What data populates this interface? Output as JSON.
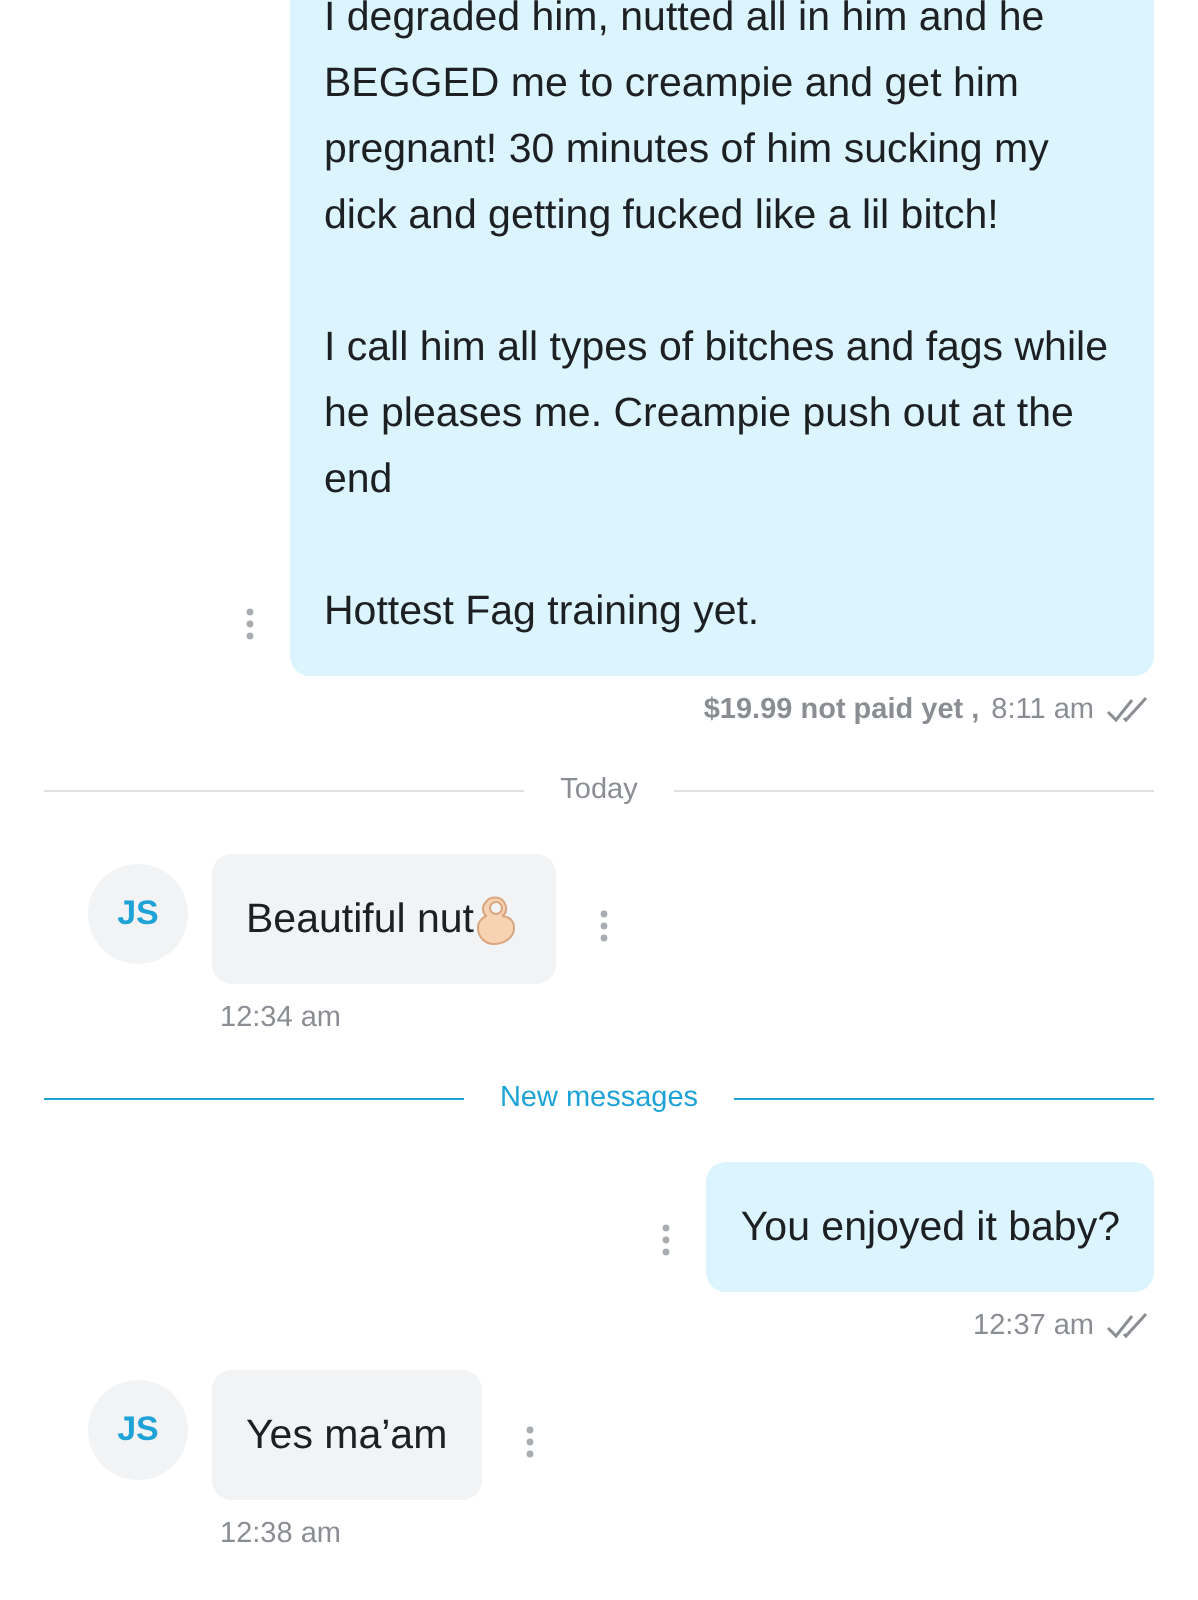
{
  "messages": [
    {
      "kind": "sent",
      "paragraphs": [
        "I degraded him, nutted all in him and he BEGGED me to creampie and get him pregnant! 30 minutes of him sucking my dick and getting fucked like a lil bitch!",
        "I call him all types of bitches and fags while he pleases me. Creampie push out at the end",
        "Hottest Fag training yet."
      ],
      "price": "$19.99 not paid yet ,",
      "time": "8:11 am",
      "read": true,
      "cut_top": true
    },
    {
      "kind": "divider",
      "label": "Today",
      "highlighted": false
    },
    {
      "kind": "received",
      "initials": "JS",
      "paragraphs": [
        "Beautiful nut"
      ],
      "emoji": true,
      "time": "12:34 am"
    },
    {
      "kind": "divider",
      "label": "New messages",
      "highlighted": true
    },
    {
      "kind": "sent",
      "paragraphs": [
        "You enjoyed it baby?"
      ],
      "time": "12:37 am",
      "read": true,
      "cut_top": false
    },
    {
      "kind": "received",
      "initials": "JS",
      "paragraphs": [
        "Yes ma’am"
      ],
      "emoji": false,
      "time": "12:38 am"
    }
  ]
}
